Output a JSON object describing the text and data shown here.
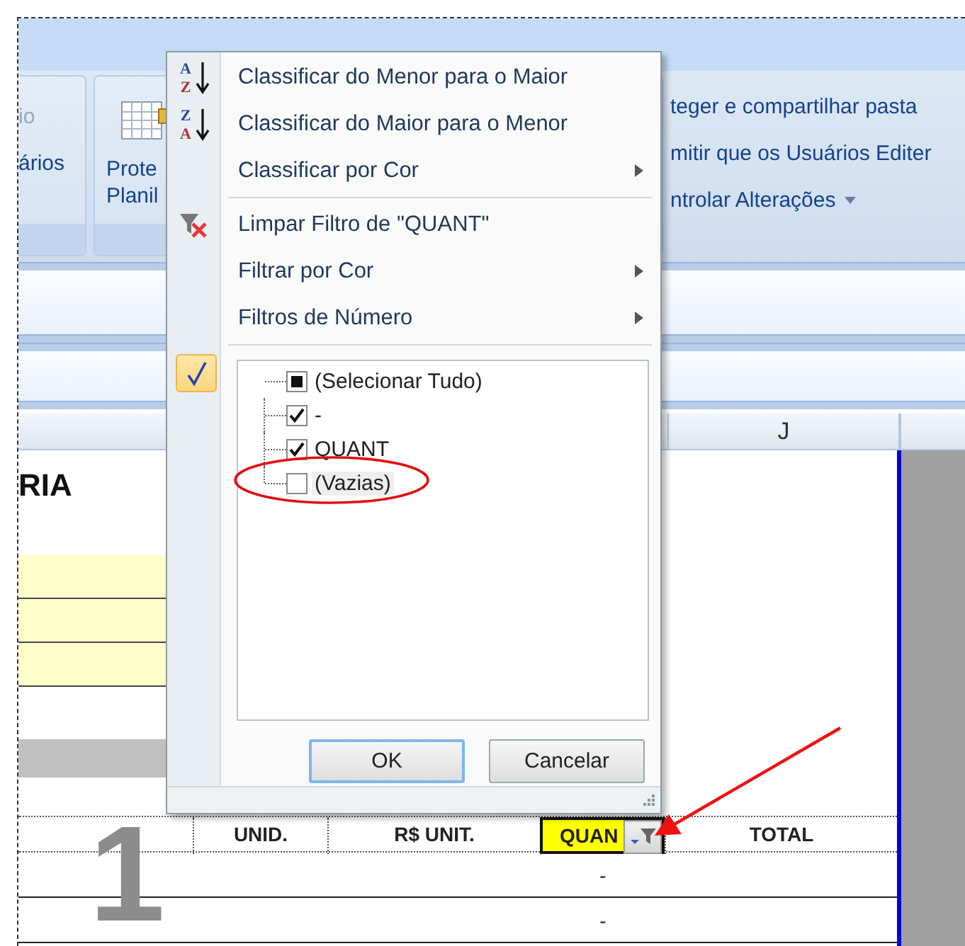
{
  "ribbon": {
    "groups": [
      {
        "lines": [
          "io",
          "ários"
        ],
        "disabled": [
          true,
          false
        ]
      },
      {
        "lines": [
          "Prote",
          "Planil"
        ]
      },
      {
        "lines": [
          "teger e compartilhar pasta",
          "mitir que os Usuários Editer",
          "ntrolar Alterações"
        ]
      }
    ]
  },
  "sheet": {
    "column_header": "J",
    "title": "RIA",
    "big_text": "1",
    "table": {
      "columns": [
        {
          "highlighted": false,
          "filter": false
        },
        {
          "label": "UNID.",
          "highlighted": false,
          "filter": false
        },
        {
          "label": "R$ UNIT.",
          "highlighted": false,
          "filter": false
        },
        {
          "label": "QUAN",
          "highlighted": true,
          "filter": true
        },
        {
          "label": "TOTAL",
          "highlighted": false,
          "filter": false
        }
      ],
      "rows": [
        [
          "",
          "",
          "",
          "-",
          ""
        ],
        [
          "",
          "",
          "",
          "-",
          ""
        ]
      ]
    }
  },
  "filter_menu": {
    "items": [
      {
        "kind": "sort",
        "label": "Classificar do Menor para o Maior",
        "icon_letters": [
          "A",
          "Z"
        ],
        "submenu": false
      },
      {
        "kind": "sort",
        "label": "Classificar do Maior para o Menor",
        "icon_letters": [
          "Z",
          "A"
        ],
        "submenu": false
      },
      {
        "kind": "plain",
        "label": "Classificar por Cor",
        "submenu": true
      },
      {
        "kind": "separator"
      },
      {
        "kind": "clear",
        "label": "Limpar Filtro de \"QUANT\"",
        "submenu": false
      },
      {
        "kind": "plain",
        "label": "Filtrar por Cor",
        "submenu": true
      },
      {
        "kind": "plain",
        "label": "Filtros de Número",
        "submenu": true
      },
      {
        "kind": "separator"
      }
    ],
    "values": [
      {
        "label": "(Selecionar Tudo)",
        "checked": true,
        "partial": true,
        "circled": false
      },
      {
        "label": "-",
        "checked": true,
        "partial": false,
        "circled": false
      },
      {
        "label": "QUANT",
        "checked": true,
        "partial": false,
        "circled": false
      },
      {
        "label": "(Vazias)",
        "checked": false,
        "partial": false,
        "circled": true
      }
    ],
    "buttons": [
      {
        "label": "OK",
        "focused": true
      },
      {
        "label": "Cancelar",
        "focused": false
      }
    ]
  }
}
